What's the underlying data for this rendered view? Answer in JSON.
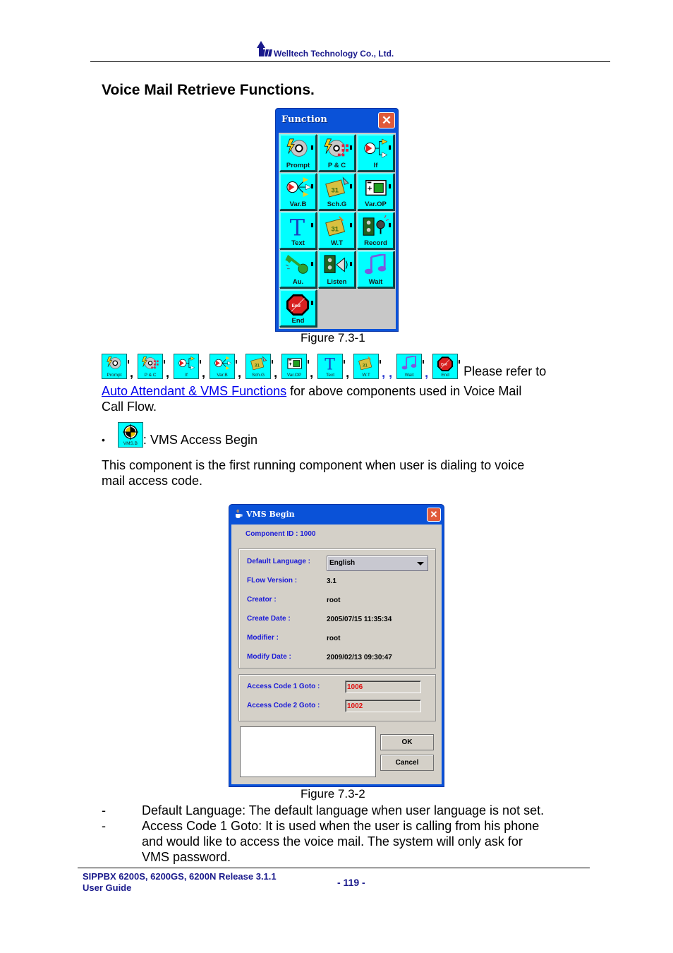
{
  "header": {
    "company": "Welltech Technology Co., Ltd.",
    "logo_icon": "welltech-logo-icon"
  },
  "section_title": "Voice Mail Retrieve Functions.",
  "function_window": {
    "title": "Function",
    "close_icon": "close-icon",
    "tiles": [
      {
        "label": "Prompt",
        "icon": "prompt-disc-icon"
      },
      {
        "label": "P & C",
        "icon": "play-collect-icon"
      },
      {
        "label": "If",
        "icon": "if-branch-icon"
      },
      {
        "label": "Var.B",
        "icon": "variable-branch-icon"
      },
      {
        "label": "Sch.G",
        "icon": "schedule-goto-icon"
      },
      {
        "label": "Var.OP",
        "icon": "variable-operation-icon"
      },
      {
        "label": "Text",
        "icon": "text-icon"
      },
      {
        "label": "W.T",
        "icon": "week-time-icon"
      },
      {
        "label": "Record",
        "icon": "record-icon"
      },
      {
        "label": "Au.",
        "icon": "authentication-key-icon"
      },
      {
        "label": "Listen",
        "icon": "listen-icon"
      },
      {
        "label": "Wait",
        "icon": "wait-music-icon"
      },
      {
        "label": "End",
        "icon": "end-stop-icon"
      }
    ]
  },
  "figure1_caption": "Figure 7.3-1",
  "icon_strip": {
    "items": [
      "Prompt",
      "P & C",
      "If",
      "Var.B",
      "Sch.G",
      "Var.OP",
      "Text",
      "W.T",
      "Wait",
      "End"
    ],
    "tail_text": "Please refer to"
  },
  "refer_paragraph": {
    "link_text": "Auto Attendant & VMS Functions",
    "rest_line1": " for above components used in Voice Mail",
    "rest_line2": "Call Flow."
  },
  "bullet": {
    "icon_label": "VMS.B",
    "text": ": VMS Access Begin"
  },
  "description": {
    "line1": "This component is the first running component when user is dialing to voice",
    "line2": "mail access code."
  },
  "vms_window": {
    "title": "VMS Begin",
    "component_id": "Component ID : 1000",
    "fields": {
      "default_language_label": "Default Language  :",
      "default_language_value": "English",
      "flow_version_label": "FLow Version :",
      "flow_version_value": "3.1",
      "creator_label": "Creator :",
      "creator_value": "root",
      "create_date_label": "Create Date :",
      "create_date_value": "2005/07/15 11:35:34",
      "modifier_label": "Modifier :",
      "modifier_value": "root",
      "modify_date_label": "Modify Date :",
      "modify_date_value": "2009/02/13 09:30:47"
    },
    "access": {
      "code1_label": "Access Code 1 Goto :",
      "code1_value": "1006",
      "code2_label": "Access Code 2 Goto :",
      "code2_value": "1002"
    },
    "ok_label": "OK",
    "cancel_label": "Cancel"
  },
  "figure2_caption": "Figure 7.3-2",
  "notes": [
    {
      "dash": "-",
      "lines": [
        "Default Language: The default language when user language is not set."
      ]
    },
    {
      "dash": "-",
      "lines": [
        "Access Code 1 Goto: It is used when the user is calling from his phone",
        "and would like to access the voice mail. The system will only ask for",
        "VMS password."
      ]
    }
  ],
  "footer": {
    "product_line1": "SIPPBX 6200S, 6200GS, 6200N Release 3.1.1",
    "product_line2": "User Guide",
    "page_number": "- 119 -"
  }
}
